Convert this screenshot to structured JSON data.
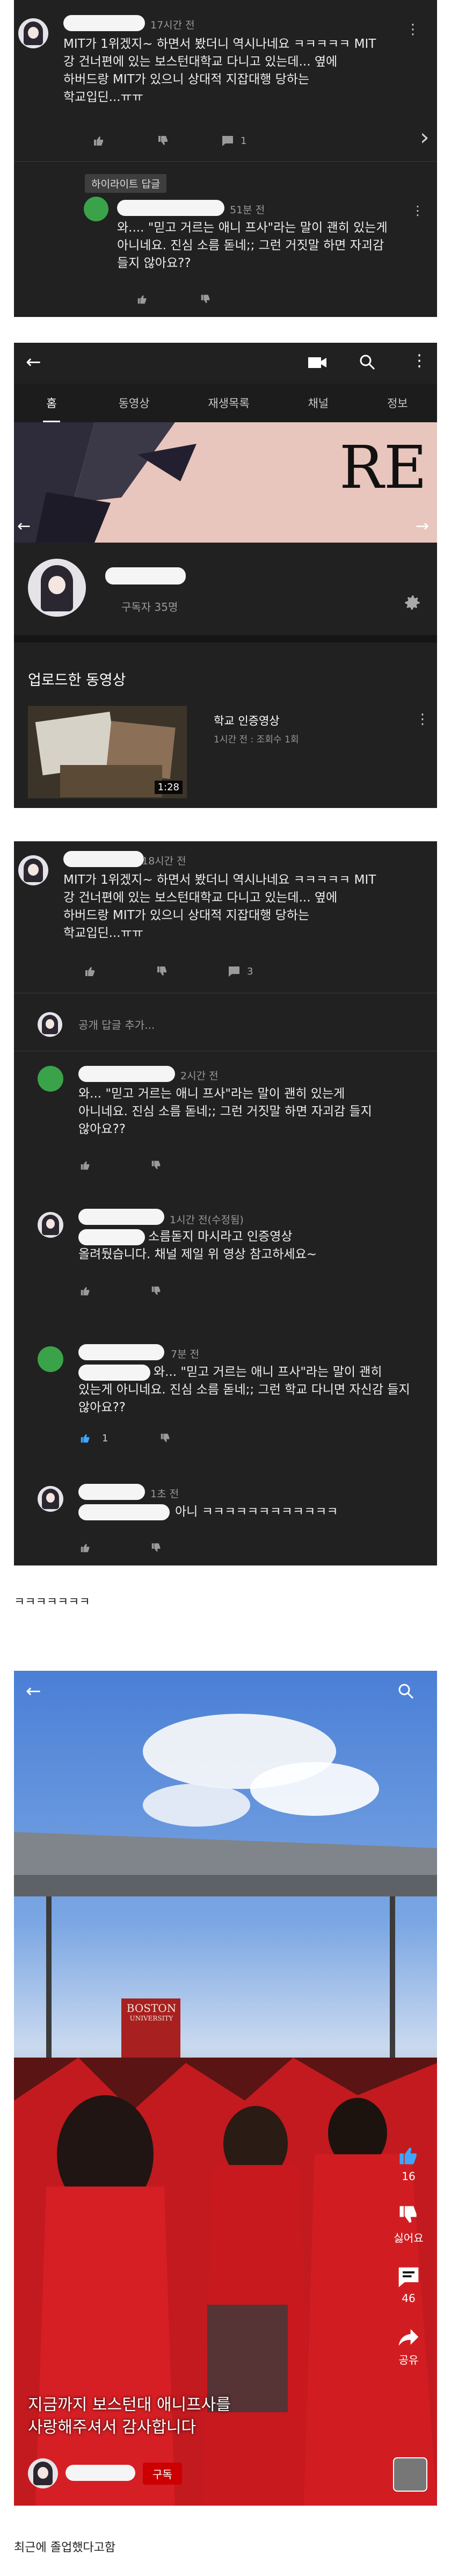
{
  "s1": {
    "time": "17시간 전",
    "comment": [
      "MIT가 1위겠지~ 하면서 봤더니 역시나네요 ㅋㅋㅋㅋㅋ MIT",
      "강 건너편에 있는 보스턴대학교 다니고 있는데... 옆에",
      "하버드랑 MIT가 있으니 상대적 지잡대행 당하는",
      "학교입딘...ㅠㅠ"
    ],
    "reply_count": "1",
    "highlight": "하이라이트 답글",
    "reply_time": "51분 전",
    "reply": [
      "와.... \"믿고 거르는 애니 프사\"라는 말이 괜히 있는게",
      "아니네요. 진심 소름 돋네;; 그런 거짓말 하면 자괴감",
      "들지 않아요??"
    ]
  },
  "s2": {
    "tabs": [
      "홈",
      "동영상",
      "재생목록",
      "채널",
      "정보"
    ],
    "banner_text": "RE",
    "subscribers": "구독자 35명",
    "uploads_title": "업로드한 동영상",
    "video_title": "학교 인증영상",
    "video_meta": "1시간 전 : 조회수 1회",
    "duration": "1:28"
  },
  "s3": {
    "c1_time": "18시간 전",
    "c1": [
      "MIT가 1위겠지~ 하면서 봤더니 역시나네요 ㅋㅋㅋㅋㅋ MIT",
      "강 건너편에 있는 보스턴대학교 다니고 있는데... 옆에",
      "하버드랑 MIT가 있으니 상대적 지잡대행 당하는",
      "학교입딘...ㅠㅠ"
    ],
    "c1_count": "3",
    "add_reply": "공개 답글 추가...",
    "r1_time": "2시간 전",
    "r1": [
      "와... \"믿고 거르는 애니 프사\"라는 말이 괜히 있는게",
      "아니네요. 진심 소름 돋네;; 그런 거짓말 하면 자괴감 들지",
      "않아요??"
    ],
    "r2_time": "1시간 전(수정됨)",
    "r2": [
      "소름돋지 마시라고 인증영상",
      "올려뒀습니다. 채널 제일 위 영상 참고하세요~"
    ],
    "r3_time": "7분 전",
    "r3": [
      "와... \"믿고 거르는 애니 프사\"라는 말이 괜히",
      "있는게 아니네요. 진심 소름 돋네;; 그런 학교 다니면 자신감 들지",
      "않아요??"
    ],
    "r3_likes": "1",
    "r4_time": "1초 전",
    "r4": "아니 ㅋㅋㅋㅋㅋㅋㅋㅋㅋㅋㅋㅋ"
  },
  "caption1": "ㅋㅋㅋㅋㅋㅋㅋ",
  "s4": {
    "sign_top": "BOSTON",
    "sign_bottom": "UNIVERSITY",
    "likes": "16",
    "dislike_label": "싫어요",
    "comments": "46",
    "share_label": "공유",
    "overlay": [
      "지금까지 보스턴대 애니프사를",
      "사랑해주셔서 감사합니다"
    ],
    "subscribe": "구독"
  },
  "caption2": "최근에 졸업했다고함"
}
